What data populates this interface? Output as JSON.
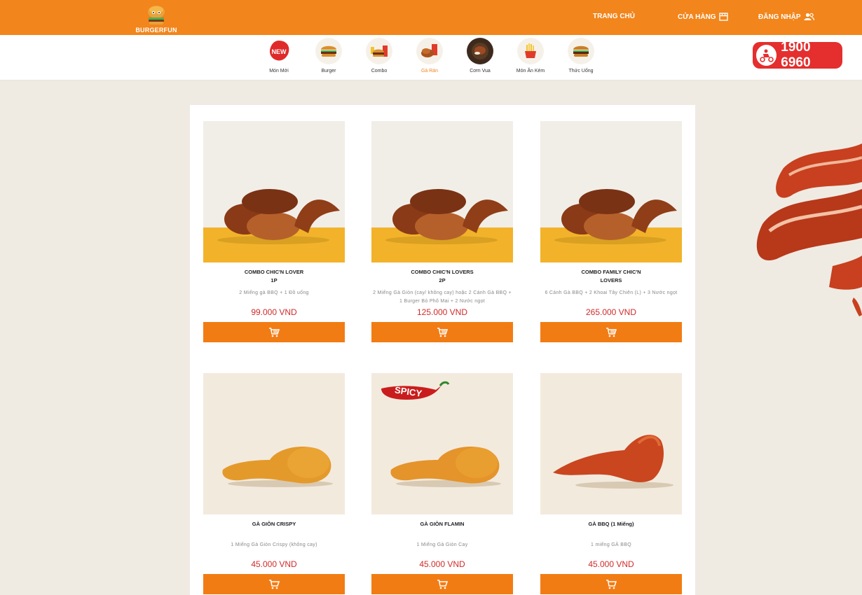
{
  "header": {
    "logo_text": "BURGERFUN",
    "nav": [
      {
        "label": "TRANG CHỦ",
        "icon": ""
      },
      {
        "label": "CỬA HÀNG",
        "icon": "store-icon"
      },
      {
        "label": "ĐĂNG NHẬP",
        "icon": "users-icon"
      }
    ]
  },
  "categories": [
    {
      "label": "Món Mới",
      "icon": "new-badge-icon"
    },
    {
      "label": "Burger",
      "icon": "burger-icon"
    },
    {
      "label": "Combo",
      "icon": "combo-icon"
    },
    {
      "label": "Gà Rán",
      "icon": "fried-chicken-icon",
      "active": true
    },
    {
      "label": "Cơm Vua",
      "icon": "rice-bowl-icon"
    },
    {
      "label": "Món Ăn Kèm",
      "icon": "fries-icon"
    },
    {
      "label": "Thức Uống",
      "icon": "drink-icon"
    }
  ],
  "hotline": {
    "number": "1900 6960",
    "icon": "delivery-scooter-icon"
  },
  "products": [
    {
      "name_line1": "COMBO CHIC'N LOVER",
      "name_line2": "1P",
      "desc": "2 Miếng gà BBQ + 1 Đồ uống",
      "price": "99.000 VND",
      "image": "chicken-combo-photo"
    },
    {
      "name_line1": "COMBO CHIC'N LOVERS",
      "name_line2": "2P",
      "desc": "2 Miếng Gà Giòn (cay/ không cay) hoặc 2 Cánh Gà BBQ + 1 Burger Bò Phô Mai + 2 Nước ngọt",
      "price": "125.000 VND",
      "image": "chicken-combo-photo"
    },
    {
      "name_line1": "COMBO FAMILY CHIC'N",
      "name_line2": "LOVERS",
      "desc": "6 Cánh Gà BBQ + 2 Khoai Tây Chiên (L) + 3 Nước ngọt",
      "price": "265.000 VND",
      "image": "chicken-combo-photo"
    },
    {
      "name_line1": "GÀ GIÒN CRISPY",
      "name_line2": "",
      "desc": "1 Miếng Gà Giòn Crispy (không cay)",
      "price": "45.000 VND",
      "image": "crispy-drumstick-photo"
    },
    {
      "name_line1": "GÀ GIÒN FLAMIN",
      "name_line2": "",
      "desc": "1 Miếng Gà Giòn Cay",
      "price": "45.000 VND",
      "image": "spicy-drumstick-photo",
      "badge": "SPICY"
    },
    {
      "name_line1": "GÀ BBQ (1 Miếng)",
      "name_line2": "",
      "desc": "1 miếng GÀ BBQ",
      "price": "45.000 VND",
      "image": "bbq-wing-photo"
    }
  ],
  "colors": {
    "brand_orange": "#f2851b",
    "button_orange": "#f27c14",
    "price_red": "#d12a2a",
    "hotline_red": "#e52e2e",
    "page_bg": "#efebe3"
  }
}
